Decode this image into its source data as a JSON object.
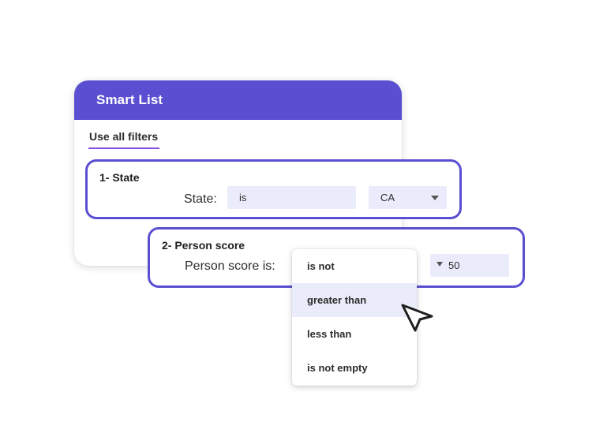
{
  "smart_list": {
    "title": "Smart List",
    "tab_label": "Use all filters"
  },
  "filters": [
    {
      "title": "1- State",
      "label": "State:",
      "operator_value": "is",
      "value": "CA"
    },
    {
      "title": "2- Person score",
      "label": "Person score is:",
      "value": "50"
    }
  ],
  "operator_dropdown": {
    "options": [
      "is not",
      "greater than",
      "less than",
      "is not empty"
    ],
    "highlighted": "greater than"
  },
  "colors": {
    "accent": "#5b4fd1",
    "tab_underline": "#8a4fe0",
    "field_background": "#ebecfb"
  },
  "icons": {
    "cursor": "arrow-pointer-icon",
    "dropdown_caret": "caret-down-icon"
  }
}
